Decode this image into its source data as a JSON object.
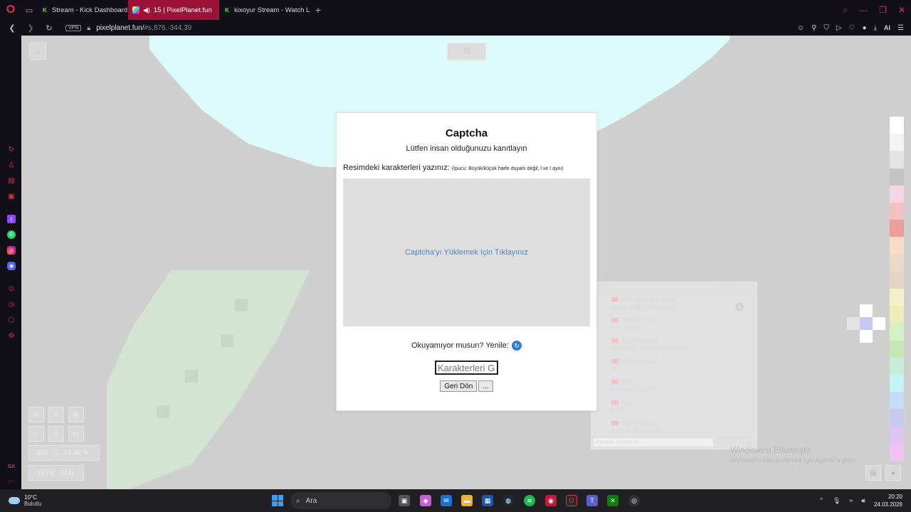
{
  "browser": {
    "tabs": [
      {
        "title": "Stream - Kick Dashboard",
        "active": false,
        "icon": "kick-icon"
      },
      {
        "title": "15 | PixelPlanet.fun",
        "active": true,
        "icon": "pixelplanet-icon"
      },
      {
        "title": "kixoyur Stream - Watch Li",
        "active": false,
        "icon": "kick-icon"
      }
    ],
    "url": {
      "host": "pixelplanet.fun/",
      "hash": "#s,876,-344,39"
    },
    "vpn_label": "VPN",
    "ai_label": "AI"
  },
  "canvas": {
    "online_counter": "15",
    "stats": {
      "online": "369",
      "pixels": "43.4k"
    },
    "coords": "(876, -344)",
    "palette": [
      "#ffffff",
      "#f4f4f4",
      "#e4e4e4",
      "#c4c4c4",
      "#f7d4e4",
      "#f4c0c0",
      "#ee9c9c",
      "#f8dcc4",
      "#ecd8c4",
      "#e4d4c4",
      "#f4f0c8",
      "#f0ecb8",
      "#d4f0c4",
      "#c4e8b4",
      "#c4ecd8",
      "#c4f4f4",
      "#c4dcf4",
      "#c8c8f4",
      "#dcc4f4",
      "#f0c4f0"
    ]
  },
  "captcha": {
    "title": "Captcha",
    "subtitle": "Lütfen insan olduğunuzu kanıtlayın",
    "instruction": "Resimdeki karakterleri yazınız:",
    "hint": "(İpucu: Büyük/küçük harfe duyarlı değil; l ve I aynı)",
    "load_text": "Captcha'yı Yüklemek İçin Tıklayınız",
    "reload_text": "Okuyamıyor musun? Yenile:",
    "input_placeholder": "Karakterleri G",
    "back_button": "Geri Dön",
    "more_button": "..."
  },
  "chat": {
    "title": "Sohbet - Channel: tr",
    "input_placeholder": "Burada sohbet et",
    "lang": "tr",
    "messages": [
      {
        "name": "[RB] LİDERİ Sokağı",
        "text": "birşey değil yaa öylesine",
        "time": "20:19:51"
      },
      {
        "name": "[KRR] Kixoyur",
        "text": "evet doğru",
        "time": "20:19:56"
      },
      {
        "name": "[KRR] kixoyur",
        "text": "ya bir şey fikrisa söyleyin az",
        "time": "20:20:03"
      },
      {
        "name": "[KRR] kixoyur",
        "text": "of",
        "time": "20:20:04"
      },
      {
        "name": "Valiz",
        "text": "sabonunuzu kim",
        "time": "20:20:08"
      },
      {
        "name": "Valiz",
        "text": "yaptı",
        "time": "20:20:09"
      },
      {
        "name": "[KRR] kixoyur",
        "text": "markalı adamım ben",
        "time": "20:20:10"
      }
    ]
  },
  "watermark": {
    "line1": "Windows'u Etkinleştir",
    "line2": "Windows'u etkinleştirmek için Ayarlar'a gidin."
  },
  "taskbar": {
    "weather_temp": "10°C",
    "weather_cond": "Bulutlu",
    "search_label": "Ara",
    "time": "20:20",
    "date": "24.03.2026"
  }
}
